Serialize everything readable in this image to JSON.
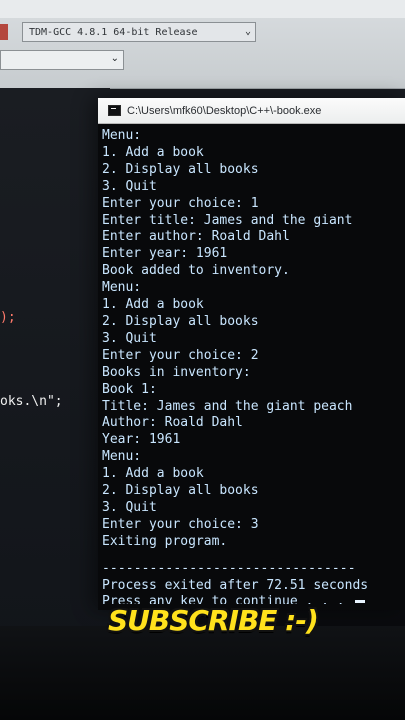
{
  "ide": {
    "compiler_label": "TDM-GCC 4.8.1 64-bit Release",
    "dropdown_arrow": "⌄",
    "editor_lines": [
      {
        "text": ");",
        "kind": "paren"
      },
      {
        "text": "oks.\\n\";",
        "kind": "string"
      }
    ]
  },
  "console": {
    "title": "C:\\Users\\mfk60\\Desktop\\C++\\-book.exe",
    "lines": [
      "Menu:",
      "1. Add a book",
      "2. Display all books",
      "3. Quit",
      "Enter your choice: 1",
      "Enter title: James and the giant",
      "Enter author: Roald Dahl",
      "Enter year: 1961",
      "Book added to inventory.",
      "Menu:",
      "1. Add a book",
      "2. Display all books",
      "3. Quit",
      "Enter your choice: 2",
      "Books in inventory:",
      "Book 1:",
      "Title: James and the giant peach",
      "Author: Roald Dahl",
      "Year: 1961",
      "Menu:",
      "1. Add a book",
      "2. Display all books",
      "3. Quit",
      "Enter your choice: 3",
      "Exiting program."
    ],
    "separator": "--------------------------------",
    "process_exit": "Process exited after 72.51 seconds",
    "continue_prompt": "Press any key to continue . . ."
  },
  "overlay": {
    "subscribe_text": "SUBSCRIBE :-)"
  },
  "colors": {
    "console_text": "#c9e6ff",
    "subscribe_fill": "#ffe11c"
  },
  "icons": {
    "console_window": "console-icon",
    "dropdown": "chevron-down-icon"
  }
}
